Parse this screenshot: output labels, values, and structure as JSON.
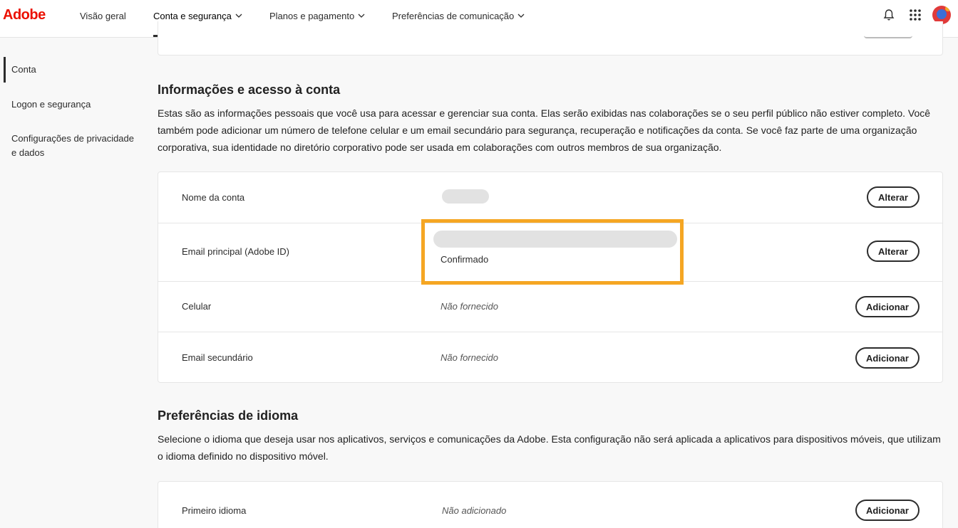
{
  "brand": {
    "logo": "Adobe",
    "color": "#eb1000"
  },
  "nav": {
    "items": [
      {
        "label": "Visão geral",
        "dropdown": false
      },
      {
        "label": "Conta e segurança",
        "dropdown": true,
        "active": true
      },
      {
        "label": "Planos e pagamento",
        "dropdown": true
      },
      {
        "label": "Preferências de comunicação",
        "dropdown": true
      }
    ],
    "icons": [
      "bell-icon",
      "apps-grid-icon",
      "avatar"
    ]
  },
  "sidebar": {
    "items": [
      {
        "label": "Conta",
        "active": true
      },
      {
        "label": "Logon e segurança"
      },
      {
        "label": "Configurações de privacidade e dados"
      }
    ]
  },
  "account_section": {
    "title": "Informações e acesso à conta",
    "description": "Estas são as informações pessoais que você usa para acessar e gerenciar sua conta. Elas serão exibidas nas colaborações se o seu perfil público não estiver completo. Você também pode adicionar um número de telefone celular e um email secundário para segurança, recuperação e notificações da conta. Se você faz parte de uma organização corporativa, sua identidade no diretório corporativo pode ser usada em colaborações com outros membros de sua organização.",
    "rows": [
      {
        "label": "Nome da conta",
        "button": "Alterar"
      },
      {
        "label": "Email principal (Adobe ID)",
        "status": "Confirmado",
        "button": "Alterar"
      },
      {
        "label": "Celular",
        "value": "Não fornecido",
        "button": "Adicionar"
      },
      {
        "label": "Email secundário",
        "value": "Não fornecido",
        "button": "Adicionar"
      }
    ]
  },
  "language_section": {
    "title": "Preferências de idioma",
    "description": "Selecione o idioma que deseja usar nos aplicativos, serviços e comunicações da Adobe. Esta configuração não será aplicada a aplicativos para dispositivos móveis, que utilizam o idioma definido no dispositivo móvel.",
    "rows": [
      {
        "label": "Primeiro idioma",
        "value": "Não adicionado",
        "button": "Adicionar"
      }
    ]
  },
  "highlight_color": "#f5a623"
}
